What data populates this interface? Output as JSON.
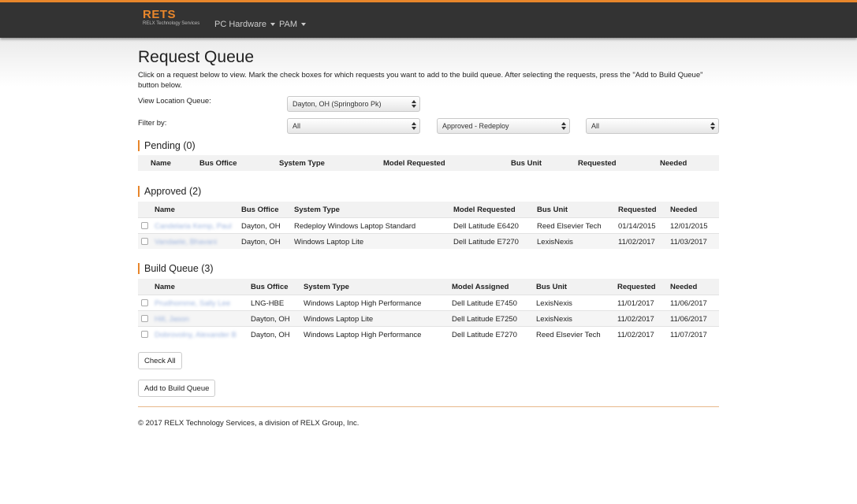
{
  "nav": {
    "logo": "RETS",
    "logo_sub": "RELX Technology Services",
    "menu": [
      {
        "label": "PC Hardware"
      },
      {
        "label": "PAM"
      }
    ]
  },
  "page": {
    "title": "Request Queue",
    "intro": "Click on a request below to view. Mark the check boxes for which requests you want to add to the build queue. After selecting the requests, press the \"Add to Build Queue\" button below."
  },
  "location": {
    "label": "View Location Queue:",
    "value": "Dayton, OH (Springboro Pk)"
  },
  "filter": {
    "label": "Filter by:",
    "values": [
      "All",
      "Approved - Redeploy",
      "All"
    ]
  },
  "pending": {
    "title": "Pending (0)",
    "headers": [
      "Name",
      "Bus Office",
      "System Type",
      "Model Requested",
      "Bus Unit",
      "Requested",
      "Needed"
    ]
  },
  "approved": {
    "title": "Approved (2)",
    "headers": [
      "Name",
      "Bus Office",
      "System Type",
      "Model Requested",
      "Bus Unit",
      "Requested",
      "Needed"
    ],
    "rows": [
      {
        "name": "Candelaria Kemp, Paul",
        "office": "Dayton, OH",
        "system": "Redeploy Windows Laptop Standard",
        "model": "Dell Latitude E6420",
        "unit": "Reed Elsevier Tech",
        "requested": "01/14/2015",
        "needed": "12/01/2015"
      },
      {
        "name": "Vandaele, Bhavani",
        "office": "Dayton, OH",
        "system": "Windows Laptop Lite",
        "model": "Dell Latitude E7270",
        "unit": "LexisNexis",
        "requested": "11/02/2017",
        "needed": "11/03/2017"
      }
    ]
  },
  "build": {
    "title": "Build Queue (3)",
    "headers": [
      "Name",
      "Bus Office",
      "System Type",
      "Model Assigned",
      "Bus Unit",
      "Requested",
      "Needed"
    ],
    "rows": [
      {
        "name": "Prudhomme, Sally Lee",
        "office": "LNG-HBE",
        "system": "Windows Laptop High Performance",
        "model": "Dell Latitude E7450",
        "unit": "LexisNexis",
        "requested": "11/01/2017",
        "needed": "11/06/2017"
      },
      {
        "name": "Hill, Jason",
        "office": "Dayton, OH",
        "system": "Windows Laptop Lite",
        "model": "Dell Latitude E7250",
        "unit": "LexisNexis",
        "requested": "11/02/2017",
        "needed": "11/06/2017"
      },
      {
        "name": "Dobrovolny, Alexander B",
        "office": "Dayton, OH",
        "system": "Windows Laptop High Performance",
        "model": "Dell Latitude E7270",
        "unit": "Reed Elsevier Tech",
        "requested": "11/02/2017",
        "needed": "11/07/2017"
      }
    ]
  },
  "buttons": {
    "check_all": "Check All",
    "add_to_build": "Add to Build Queue"
  },
  "footer": "© 2017 RELX Technology Services, a division of RELX Group, Inc."
}
